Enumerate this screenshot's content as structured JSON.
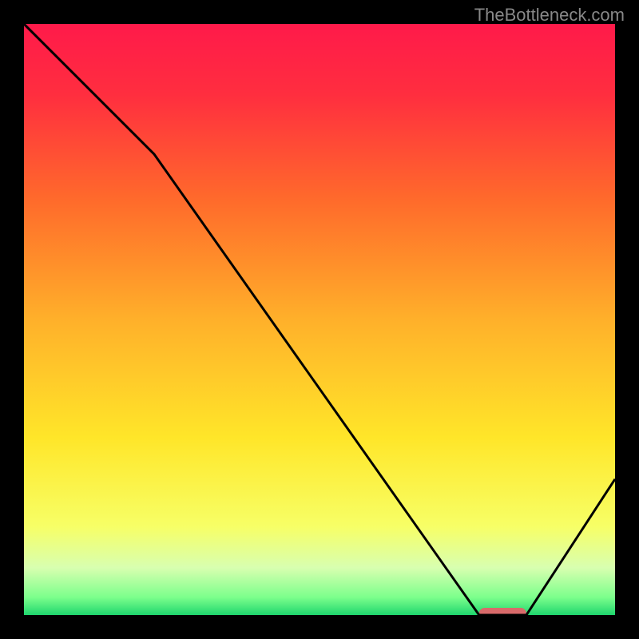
{
  "watermark": "TheBottleneck.com",
  "chart_data": {
    "type": "line",
    "title": "",
    "xlabel": "",
    "ylabel": "",
    "xlim": [
      0,
      100
    ],
    "ylim": [
      0,
      100
    ],
    "x": [
      0,
      22,
      77,
      85,
      100
    ],
    "values": [
      100,
      78,
      0,
      0,
      23
    ],
    "optimal_segment": {
      "x_start": 77,
      "x_end": 85,
      "y": 0
    },
    "background_gradient_stops": [
      {
        "offset": 0.0,
        "color": "#ff1a4a"
      },
      {
        "offset": 0.12,
        "color": "#ff2e3f"
      },
      {
        "offset": 0.3,
        "color": "#ff6b2b"
      },
      {
        "offset": 0.5,
        "color": "#ffb02a"
      },
      {
        "offset": 0.7,
        "color": "#ffe629"
      },
      {
        "offset": 0.85,
        "color": "#f7ff66"
      },
      {
        "offset": 0.92,
        "color": "#d8ffb0"
      },
      {
        "offset": 0.97,
        "color": "#7cff8c"
      },
      {
        "offset": 1.0,
        "color": "#1fd66e"
      }
    ],
    "line_color": "#000000",
    "marker_color": "#d86a6a"
  }
}
